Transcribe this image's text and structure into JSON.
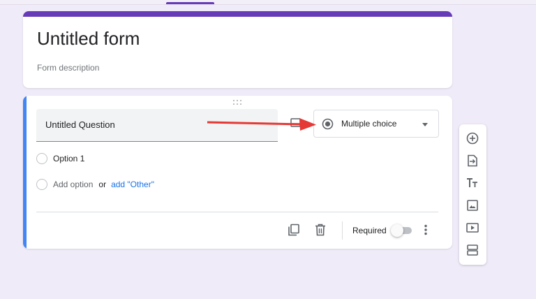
{
  "form": {
    "title": "Untitled form",
    "description_placeholder": "Form description"
  },
  "question": {
    "title": "Untitled Question",
    "type": "Multiple choice",
    "options": [
      "Option 1"
    ],
    "add_option_label": "Add option",
    "or_label": "or",
    "add_other_label": "add \"Other\""
  },
  "footer": {
    "required_label": "Required",
    "required_on": false
  },
  "icons": {
    "image": "image-icon",
    "duplicate": "copy-icon",
    "delete": "trash-icon",
    "more": "more-vertical-icon",
    "side_tools": [
      "add-question-icon",
      "import-questions-icon",
      "title-text-icon",
      "add-image-icon",
      "add-video-icon",
      "add-section-icon"
    ]
  },
  "colors": {
    "accent_purple": "#673ab7",
    "active_blue": "#4285f4",
    "link_blue": "#1a73e8",
    "annotation_red": "#e53935",
    "background": "#f0ebf8"
  }
}
